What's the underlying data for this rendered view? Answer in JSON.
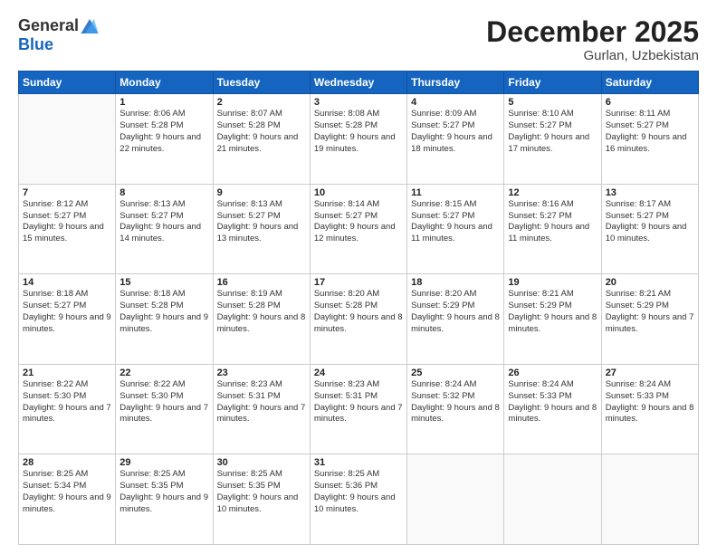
{
  "logo": {
    "general": "General",
    "blue": "Blue"
  },
  "title": "December 2025",
  "location": "Gurlan, Uzbekistan",
  "days_header": [
    "Sunday",
    "Monday",
    "Tuesday",
    "Wednesday",
    "Thursday",
    "Friday",
    "Saturday"
  ],
  "weeks": [
    [
      {
        "day": "",
        "empty": true
      },
      {
        "day": "1",
        "sunrise": "Sunrise: 8:06 AM",
        "sunset": "Sunset: 5:28 PM",
        "daylight": "Daylight: 9 hours and 22 minutes."
      },
      {
        "day": "2",
        "sunrise": "Sunrise: 8:07 AM",
        "sunset": "Sunset: 5:28 PM",
        "daylight": "Daylight: 9 hours and 21 minutes."
      },
      {
        "day": "3",
        "sunrise": "Sunrise: 8:08 AM",
        "sunset": "Sunset: 5:28 PM",
        "daylight": "Daylight: 9 hours and 19 minutes."
      },
      {
        "day": "4",
        "sunrise": "Sunrise: 8:09 AM",
        "sunset": "Sunset: 5:27 PM",
        "daylight": "Daylight: 9 hours and 18 minutes."
      },
      {
        "day": "5",
        "sunrise": "Sunrise: 8:10 AM",
        "sunset": "Sunset: 5:27 PM",
        "daylight": "Daylight: 9 hours and 17 minutes."
      },
      {
        "day": "6",
        "sunrise": "Sunrise: 8:11 AM",
        "sunset": "Sunset: 5:27 PM",
        "daylight": "Daylight: 9 hours and 16 minutes."
      }
    ],
    [
      {
        "day": "7",
        "sunrise": "Sunrise: 8:12 AM",
        "sunset": "Sunset: 5:27 PM",
        "daylight": "Daylight: 9 hours and 15 minutes."
      },
      {
        "day": "8",
        "sunrise": "Sunrise: 8:13 AM",
        "sunset": "Sunset: 5:27 PM",
        "daylight": "Daylight: 9 hours and 14 minutes."
      },
      {
        "day": "9",
        "sunrise": "Sunrise: 8:13 AM",
        "sunset": "Sunset: 5:27 PM",
        "daylight": "Daylight: 9 hours and 13 minutes."
      },
      {
        "day": "10",
        "sunrise": "Sunrise: 8:14 AM",
        "sunset": "Sunset: 5:27 PM",
        "daylight": "Daylight: 9 hours and 12 minutes."
      },
      {
        "day": "11",
        "sunrise": "Sunrise: 8:15 AM",
        "sunset": "Sunset: 5:27 PM",
        "daylight": "Daylight: 9 hours and 11 minutes."
      },
      {
        "day": "12",
        "sunrise": "Sunrise: 8:16 AM",
        "sunset": "Sunset: 5:27 PM",
        "daylight": "Daylight: 9 hours and 11 minutes."
      },
      {
        "day": "13",
        "sunrise": "Sunrise: 8:17 AM",
        "sunset": "Sunset: 5:27 PM",
        "daylight": "Daylight: 9 hours and 10 minutes."
      }
    ],
    [
      {
        "day": "14",
        "sunrise": "Sunrise: 8:18 AM",
        "sunset": "Sunset: 5:27 PM",
        "daylight": "Daylight: 9 hours and 9 minutes."
      },
      {
        "day": "15",
        "sunrise": "Sunrise: 8:18 AM",
        "sunset": "Sunset: 5:28 PM",
        "daylight": "Daylight: 9 hours and 9 minutes."
      },
      {
        "day": "16",
        "sunrise": "Sunrise: 8:19 AM",
        "sunset": "Sunset: 5:28 PM",
        "daylight": "Daylight: 9 hours and 8 minutes."
      },
      {
        "day": "17",
        "sunrise": "Sunrise: 8:20 AM",
        "sunset": "Sunset: 5:28 PM",
        "daylight": "Daylight: 9 hours and 8 minutes."
      },
      {
        "day": "18",
        "sunrise": "Sunrise: 8:20 AM",
        "sunset": "Sunset: 5:29 PM",
        "daylight": "Daylight: 9 hours and 8 minutes."
      },
      {
        "day": "19",
        "sunrise": "Sunrise: 8:21 AM",
        "sunset": "Sunset: 5:29 PM",
        "daylight": "Daylight: 9 hours and 8 minutes."
      },
      {
        "day": "20",
        "sunrise": "Sunrise: 8:21 AM",
        "sunset": "Sunset: 5:29 PM",
        "daylight": "Daylight: 9 hours and 7 minutes."
      }
    ],
    [
      {
        "day": "21",
        "sunrise": "Sunrise: 8:22 AM",
        "sunset": "Sunset: 5:30 PM",
        "daylight": "Daylight: 9 hours and 7 minutes."
      },
      {
        "day": "22",
        "sunrise": "Sunrise: 8:22 AM",
        "sunset": "Sunset: 5:30 PM",
        "daylight": "Daylight: 9 hours and 7 minutes."
      },
      {
        "day": "23",
        "sunrise": "Sunrise: 8:23 AM",
        "sunset": "Sunset: 5:31 PM",
        "daylight": "Daylight: 9 hours and 7 minutes."
      },
      {
        "day": "24",
        "sunrise": "Sunrise: 8:23 AM",
        "sunset": "Sunset: 5:31 PM",
        "daylight": "Daylight: 9 hours and 7 minutes."
      },
      {
        "day": "25",
        "sunrise": "Sunrise: 8:24 AM",
        "sunset": "Sunset: 5:32 PM",
        "daylight": "Daylight: 9 hours and 8 minutes."
      },
      {
        "day": "26",
        "sunrise": "Sunrise: 8:24 AM",
        "sunset": "Sunset: 5:33 PM",
        "daylight": "Daylight: 9 hours and 8 minutes."
      },
      {
        "day": "27",
        "sunrise": "Sunrise: 8:24 AM",
        "sunset": "Sunset: 5:33 PM",
        "daylight": "Daylight: 9 hours and 8 minutes."
      }
    ],
    [
      {
        "day": "28",
        "sunrise": "Sunrise: 8:25 AM",
        "sunset": "Sunset: 5:34 PM",
        "daylight": "Daylight: 9 hours and 9 minutes."
      },
      {
        "day": "29",
        "sunrise": "Sunrise: 8:25 AM",
        "sunset": "Sunset: 5:35 PM",
        "daylight": "Daylight: 9 hours and 9 minutes."
      },
      {
        "day": "30",
        "sunrise": "Sunrise: 8:25 AM",
        "sunset": "Sunset: 5:35 PM",
        "daylight": "Daylight: 9 hours and 10 minutes."
      },
      {
        "day": "31",
        "sunrise": "Sunrise: 8:25 AM",
        "sunset": "Sunset: 5:36 PM",
        "daylight": "Daylight: 9 hours and 10 minutes."
      },
      {
        "day": "",
        "empty": true
      },
      {
        "day": "",
        "empty": true
      },
      {
        "day": "",
        "empty": true
      }
    ]
  ]
}
